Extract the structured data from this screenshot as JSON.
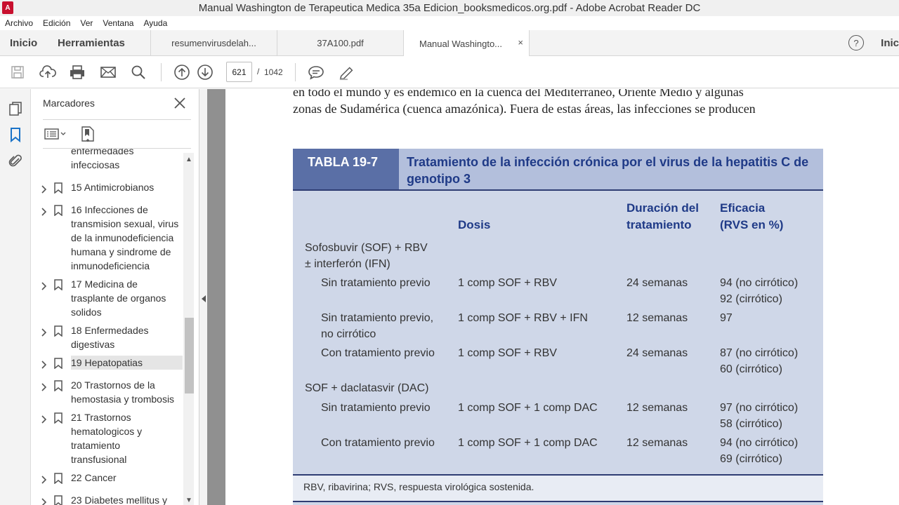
{
  "window": {
    "title": "Manual Washington de Terapeutica Medica 35a Edicion_booksmedicos.org.pdf - Adobe Acrobat Reader DC"
  },
  "menu": [
    "Archivo",
    "Edición",
    "Ver",
    "Ventana",
    "Ayuda"
  ],
  "nav": {
    "home": "Inicio",
    "tools": "Herramientas",
    "right_label": "Inic"
  },
  "tabs": [
    {
      "label": "resumenvirusdelah..."
    },
    {
      "label": "37A100.pdf"
    },
    {
      "label": "Manual Washingto...",
      "close": "×"
    }
  ],
  "help_icon": "?",
  "toolbar": {
    "icons": [
      "save-icon",
      "upload-icon",
      "print-icon",
      "email-icon",
      "search-icon",
      "page-up-icon",
      "page-down-icon",
      "comment-icon",
      "highlight-pen-icon"
    ],
    "page_current": "621",
    "page_sep": "/",
    "page_total": "1042"
  },
  "bookmarks": {
    "title": "Marcadores",
    "items": [
      {
        "label": "enfermedades\ninfecciosas",
        "partial": true
      },
      {
        "label": "15 Antimicrobianos"
      },
      {
        "label": "16 Infecciones de\ntransmision sexual, virus\nde la inmunodeficiencia\nhumana y sindrome de\ninmunodeficiencia"
      },
      {
        "label": "17 Medicina de\ntrasplante de organos\nsolidos"
      },
      {
        "label": "18 Enfermedades\ndigestivas"
      },
      {
        "label": "19 Hepatopatias",
        "selected": true
      },
      {
        "label": "20 Trastornos de la\nhemostasia y trombosis"
      },
      {
        "label": "21 Trastornos\nhematologicos y\ntratamiento\ntransfusional"
      },
      {
        "label": "22 Cancer"
      },
      {
        "label": "23 Diabetes mellitus y"
      }
    ]
  },
  "document": {
    "text_lines": [
      "en todo el mundo y es endémico en la cuenca del Mediterráneo, Oriente Medio y algunas",
      "zonas de Sudamérica (cuenca amazónica). Fuera de estas áreas, las infecciones se producen"
    ],
    "table": {
      "tag": "TABLA 19-7",
      "title": "Tratamiento de la infección crónica por el virus de la hepatitis C de genotipo 3",
      "headers": {
        "dose": "Dosis",
        "duration": "Duración del\ntratamiento",
        "efficacy": "Eficacia\n(RVS en %)"
      },
      "groups": [
        {
          "label": "Sofosbuvir (SOF) + RBV\n   ± interferón (IFN)"
        },
        {
          "label": "SOF + daclatasvir (DAC)"
        }
      ],
      "rows": [
        {
          "case": "Sin tratamiento previo",
          "dose": "1 comp SOF + RBV",
          "duration": "24 semanas",
          "efficacy": "94 (no cirrótico)\n92 (cirrótico)"
        },
        {
          "case": "Sin tratamiento previo,\n   no cirrótico",
          "dose": "1 comp SOF + RBV + IFN",
          "duration": "12 semanas",
          "efficacy": "97"
        },
        {
          "case": "Con tratamiento previo",
          "dose": "1 comp SOF + RBV",
          "duration": "24 semanas",
          "efficacy": "87 (no cirrótico)\n60 (cirrótico)"
        },
        {
          "case": "Sin tratamiento previo",
          "dose": "1 comp SOF + 1 comp DAC",
          "duration": "12 semanas",
          "efficacy": "97 (no cirrótico)\n58 (cirrótico)"
        },
        {
          "case": "Con tratamiento previo",
          "dose": "1 comp SOF + 1 comp DAC",
          "duration": "12 semanas",
          "efficacy": "94 (no cirrótico)\n69 (cirrótico)"
        }
      ],
      "footnote": "RBV, ribavirina; RVS, respuesta virológica sostenida."
    }
  },
  "colors": {
    "table_bg": "#cfd7e8",
    "table_head": "#b3bfdc",
    "tag_bg": "#5a6fa6",
    "title_blue": "#1f3a87",
    "acrobat_red": "#c8102e",
    "bookmark_blue": "#1a73c8"
  }
}
